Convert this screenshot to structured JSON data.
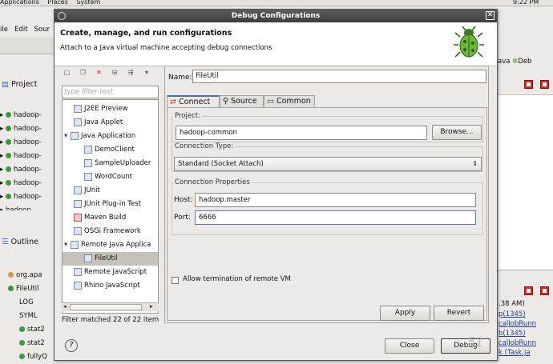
{
  "desktop": {
    "menus": [
      "Applications",
      "Places",
      "System"
    ],
    "clock": "9:22 PM"
  },
  "eclipse_left": {
    "menus": [
      "ile",
      "Edit",
      "Sour"
    ],
    "project_tab": "Project",
    "project_items": [
      "hadoop-",
      "hadoop-",
      "hadoop-",
      "hadoop-",
      "hadoop-",
      "hadoop-",
      "hadoop-",
      "hadoop"
    ],
    "outline_tab": "Outline",
    "outline_items": [
      "org.apa",
      "FileUtil",
      "LOG",
      "SYML",
      "stat2",
      "stat2",
      "fullyQ"
    ]
  },
  "eclipse_right": {
    "perspectives": [
      "ava",
      "Deb"
    ],
    "time_fragment": ".38 AM)",
    "links": [
      "p(1345)",
      "calJobRunn",
      "b(1345)",
      "calJobRunn",
      "k (Task.ja"
    ]
  },
  "dialog": {
    "title": "Debug Configurations",
    "header_title": "Create, manage, and run configurations",
    "header_subtitle": "Attach to a Java virtual machine accepting debug connections",
    "filter_placeholder": "type filter text",
    "tree": [
      {
        "label": "J2EE Preview",
        "indent": 1,
        "icon": "j2ee-icon"
      },
      {
        "label": "Java Applet",
        "indent": 1,
        "icon": "applet-icon"
      },
      {
        "label": "Java Application",
        "indent": 0,
        "icon": "java-app-icon",
        "twisty": "▾"
      },
      {
        "label": "DemoClient",
        "indent": 2,
        "icon": "java-class-icon"
      },
      {
        "label": "SampleUploader",
        "indent": 2,
        "icon": "java-class-icon"
      },
      {
        "label": "WordCount",
        "indent": 2,
        "icon": "java-class-icon"
      },
      {
        "label": "JUnit",
        "indent": 1,
        "icon": "junit-icon"
      },
      {
        "label": "JUnit Plug-in Test",
        "indent": 1,
        "icon": "junit-plugin-icon"
      },
      {
        "label": "Maven Build",
        "indent": 1,
        "icon": "maven-icon"
      },
      {
        "label": "OSGi Framework",
        "indent": 1,
        "icon": "osgi-icon"
      },
      {
        "label": "Remote Java Applica",
        "indent": 0,
        "icon": "remote-java-icon",
        "twisty": "▾"
      },
      {
        "label": "FileUtil",
        "indent": 2,
        "icon": "remote-config-icon",
        "selected": true
      },
      {
        "label": "Remote JavaScript",
        "indent": 1,
        "icon": "remote-js-icon"
      },
      {
        "label": "Rhino JavaScript",
        "indent": 1,
        "icon": "rhino-icon"
      }
    ],
    "filter_status": "Filter matched 22 of 22 item",
    "name_label": "Name:",
    "name_value": "FileUtil",
    "tabs": {
      "connect": "Connect",
      "source": "Source",
      "common": "Common"
    },
    "project_group": "Project:",
    "project_value": "hadoop-common",
    "browse_label": "Browse...",
    "connection_type_group": "Connection Type:",
    "connection_type_value": "Standard (Socket Attach)",
    "connection_props_group": "Connection Properties",
    "host_label": "Host:",
    "host_value": "hadoop.master",
    "port_label": "Port:",
    "port_value": "6666",
    "allow_termination_label": "Allow termination of remote VM",
    "allow_termination_checked": false,
    "apply_label": "Apply",
    "revert_label": "Revert",
    "close_label": "Close",
    "debug_label": "Debug",
    "help_label": "?"
  },
  "watermark": "51"
}
